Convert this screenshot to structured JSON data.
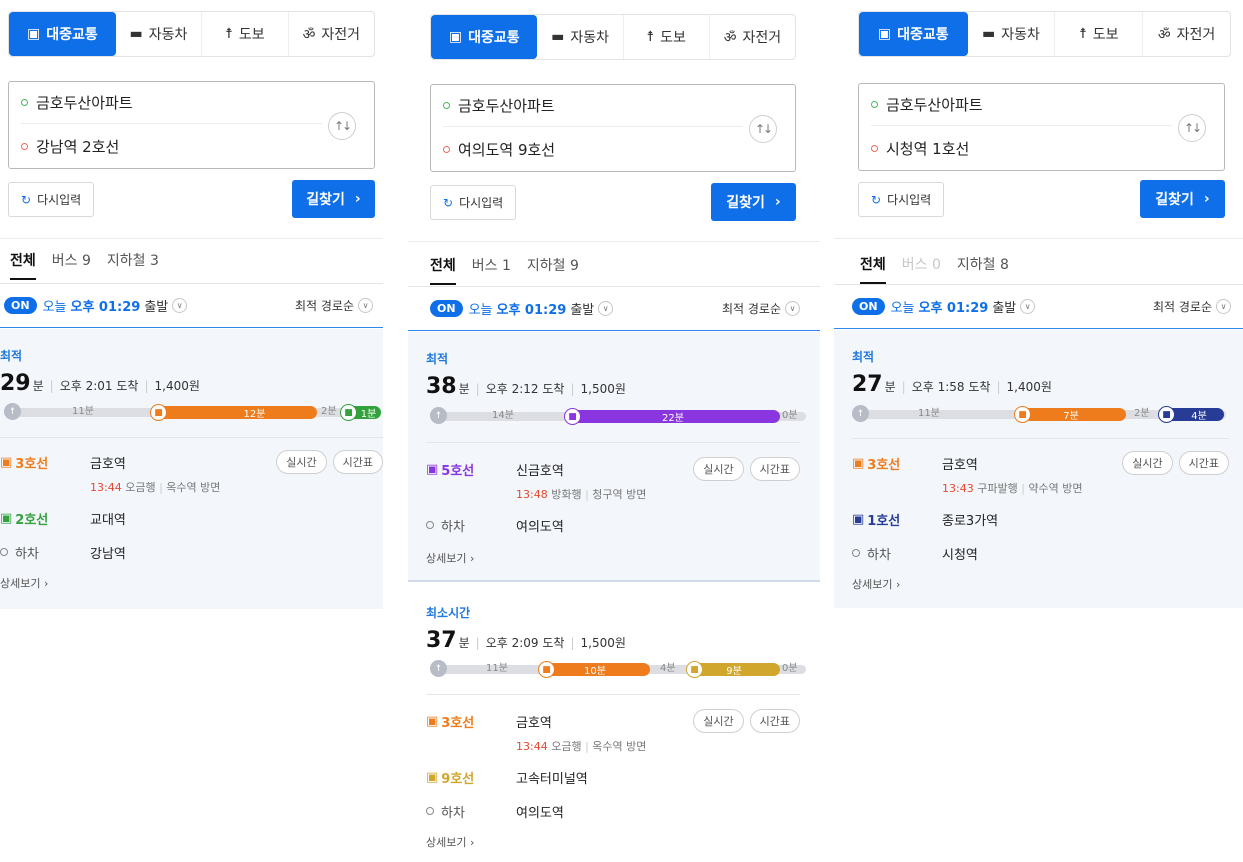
{
  "colors": {
    "accent": "#0f6fe8",
    "line3": "#ef7c1c",
    "line2": "#33a23d",
    "line5": "#8936e0",
    "line9": "#d1a62c",
    "line1": "#263c96",
    "walk": "#b7bcc6"
  },
  "panels": [
    {
      "modes": [
        {
          "label": "대중교통",
          "icon": "bus-icon"
        },
        {
          "label": "자동차",
          "icon": "car-icon"
        },
        {
          "label": "도보",
          "icon": "walk-icon"
        },
        {
          "label": "자전거",
          "icon": "bike-icon"
        }
      ],
      "origin": "금호두산아파트",
      "destination": "강남역 2호선",
      "reset_label": "다시입력",
      "search_label": "길찾기",
      "tabs": [
        {
          "label": "전체"
        },
        {
          "label": "버스 9"
        },
        {
          "label": "지하철 3"
        }
      ],
      "departure": {
        "on": "ON",
        "today": "오늘",
        "time": "오후 01:29",
        "suffix": "출발"
      },
      "sort_label": "최적 경로순",
      "routes": [
        {
          "label": "최적",
          "minutes": "29",
          "unit": "분",
          "arrival": "오후 2:01 도착",
          "fare": "1,400원",
          "walk_start": "11분",
          "segments": [
            {
              "text": "12분",
              "line": "line3"
            }
          ],
          "walk_mid": "2분",
          "last": "1분",
          "steps": [
            {
              "line": "3호선",
              "station": "금호역",
              "time": "13:44",
              "dir": "오금행",
              "dir2": "옥수역 방면",
              "buttons": [
                "실시간",
                "시간표"
              ]
            },
            {
              "line": "2호선",
              "station": "교대역"
            },
            {
              "line": "하차",
              "station": "강남역"
            }
          ],
          "more": "상세보기"
        }
      ]
    },
    {
      "modes": [
        {
          "label": "대중교통",
          "icon": "bus-icon"
        },
        {
          "label": "자동차",
          "icon": "car-icon"
        },
        {
          "label": "도보",
          "icon": "walk-icon"
        },
        {
          "label": "자전거",
          "icon": "bike-icon"
        }
      ],
      "origin": "금호두산아파트",
      "destination": "여의도역 9호선",
      "reset_label": "다시입력",
      "search_label": "길찾기",
      "tabs": [
        {
          "label": "전체"
        },
        {
          "label": "버스 1"
        },
        {
          "label": "지하철 9"
        }
      ],
      "departure": {
        "on": "ON",
        "today": "오늘",
        "time": "오후 01:29",
        "suffix": "출발"
      },
      "sort_label": "최적 경로순",
      "routes": [
        {
          "label": "최적",
          "minutes": "38",
          "unit": "분",
          "arrival": "오후 2:12 도착",
          "fare": "1,500원",
          "walk_start": "14분",
          "segments": [
            {
              "text": "22분",
              "line": "line5"
            }
          ],
          "walk_end": "0분",
          "steps": [
            {
              "line": "5호선",
              "station": "신금호역",
              "time": "13:48",
              "dir": "방화행",
              "dir2": "청구역 방면",
              "buttons": [
                "실시간",
                "시간표"
              ]
            },
            {
              "line": "하차",
              "station": "여의도역"
            }
          ],
          "more": "상세보기"
        },
        {
          "label": "최소시간",
          "minutes": "37",
          "unit": "분",
          "arrival": "오후 2:09 도착",
          "fare": "1,500원",
          "walk_start": "11분",
          "segments": [
            {
              "text": "10분",
              "line": "line3"
            },
            {
              "text": "9분",
              "line": "line9"
            }
          ],
          "walk_mid": "4분",
          "walk_end": "0분",
          "steps": [
            {
              "line": "3호선",
              "station": "금호역",
              "time": "13:44",
              "dir": "오금행",
              "dir2": "옥수역 방면",
              "buttons": [
                "실시간",
                "시간표"
              ]
            },
            {
              "line": "9호선",
              "station": "고속터미널역"
            },
            {
              "line": "하차",
              "station": "여의도역"
            }
          ],
          "more": "상세보기"
        }
      ]
    },
    {
      "modes": [
        {
          "label": "대중교통",
          "icon": "bus-icon"
        },
        {
          "label": "자동차",
          "icon": "car-icon"
        },
        {
          "label": "도보",
          "icon": "walk-icon"
        },
        {
          "label": "자전거",
          "icon": "bike-icon"
        }
      ],
      "origin": "금호두산아파트",
      "destination": "시청역 1호선",
      "reset_label": "다시입력",
      "search_label": "길찾기",
      "tabs": [
        {
          "label": "전체"
        },
        {
          "label": "버스 0"
        },
        {
          "label": "지하철 8"
        }
      ],
      "departure": {
        "on": "ON",
        "today": "오늘",
        "time": "오후 01:29",
        "suffix": "출발"
      },
      "sort_label": "최적 경로순",
      "routes": [
        {
          "label": "최적",
          "minutes": "27",
          "unit": "분",
          "arrival": "오후 1:58 도착",
          "fare": "1,400원",
          "walk_start": "11분",
          "segments": [
            {
              "text": "7분",
              "line": "line3"
            }
          ],
          "walk_mid": "2분",
          "last": "4분",
          "steps": [
            {
              "line": "3호선",
              "station": "금호역",
              "time": "13:43",
              "dir": "구파발행",
              "dir2": "약수역 방면",
              "buttons": [
                "실시간",
                "시간표"
              ]
            },
            {
              "line": "1호선",
              "station": "종로3가역"
            },
            {
              "line": "하차",
              "station": "시청역"
            }
          ],
          "more": "상세보기"
        }
      ]
    }
  ]
}
